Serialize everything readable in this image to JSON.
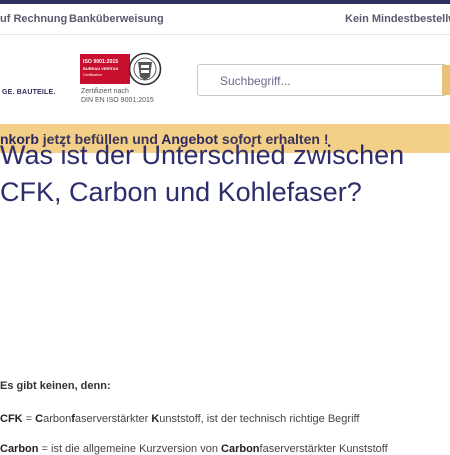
{
  "topbar": {
    "payment_invoice": "uf Rechnung",
    "payment_transfer": "Banküberweisung",
    "min_order": "Kein Mindestbestellwe"
  },
  "header": {
    "logo_tagline": "GE. BAUTEILE.",
    "cert": {
      "badge_line1": "ISO 9001:2015",
      "badge_line2": "BUREAU VERITAS",
      "badge_line3": "Certification",
      "caption_line1": "Zertifiziert nach",
      "caption_line2": "DIN EN ISO 9001:2015"
    },
    "search": {
      "placeholder": "Suchbegriff..."
    }
  },
  "banner": {
    "part1": "nkorb",
    "part2": " jetzt befüllen und ",
    "part3": "Angebot",
    "part4": " sofort erhalten !"
  },
  "article": {
    "title_line1": "Was ist der Unterschied zwischen",
    "title_line2": "CFK, Carbon und Kohlefaser?",
    "intro": "Es gibt keinen, denn:",
    "p1": {
      "a": "CFK",
      "b": " = ",
      "c": "C",
      "d": "arbon",
      "e": "f",
      "f": "aserverstärkter ",
      "g": "K",
      "h": "unststoff, ist der technisch richtige Begriff"
    },
    "p2": {
      "a": "Carbon",
      "b": " = ist die allgemeine Kurzversion von ",
      "c": "Carbon",
      "d": "faserverstärkter Kunststoff"
    }
  },
  "colors": {
    "navy": "#2f2f5d",
    "banner": "#f3cf87",
    "search_button": "#e9c279",
    "badge_red": "#c8102e"
  }
}
